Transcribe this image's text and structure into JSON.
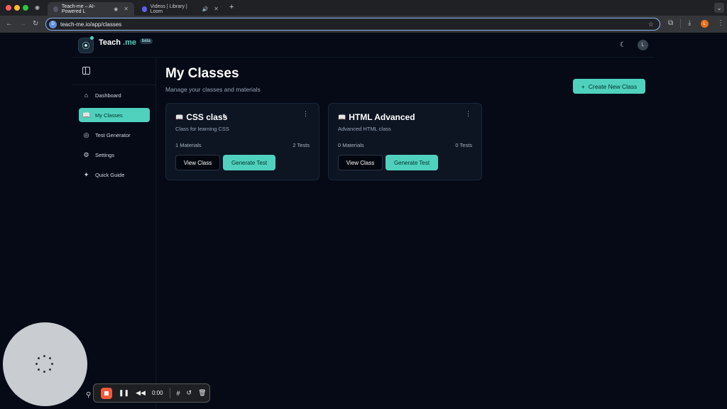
{
  "browser": {
    "tabs": [
      {
        "title": "Teach-me – AI-Powered L"
      },
      {
        "title": "Videos | Library | Loom"
      }
    ],
    "new_tab": "+",
    "url": "teach-me.io/app/classes",
    "profile_initial": "L"
  },
  "app": {
    "brand_main": "Teach",
    "brand_accent": ".me",
    "beta": "beta",
    "user_initial": "L",
    "colors": {
      "accent": "#4fd1bd",
      "background": "#050a16",
      "card": "#0d1523"
    }
  },
  "sidebar": {
    "items": [
      {
        "label": "Dashboard",
        "icon": "home-icon"
      },
      {
        "label": "My Classes",
        "icon": "book-icon",
        "active": true
      },
      {
        "label": "Test Generator",
        "icon": "brain-icon"
      },
      {
        "label": "Settings",
        "icon": "gear-icon"
      },
      {
        "label": "Quick Guide",
        "icon": "sparkle-icon"
      }
    ]
  },
  "main": {
    "title": "My Classes",
    "subtitle": "Manage your classes and materials",
    "create_button": "Create New Class",
    "create_icon": "+"
  },
  "classes": [
    {
      "title": "CSS class",
      "description": "Class for learning CSS",
      "materials": "1 Materials",
      "tests": "2 Tests",
      "view_label": "View Class",
      "generate_label": "Generate Test"
    },
    {
      "title": "HTML Advanced",
      "description": "Advanced HTML class",
      "materials": "0 Materials",
      "tests": "0 Tests",
      "view_label": "View Class",
      "generate_label": "Generate Test"
    }
  ],
  "recorder": {
    "time": "0:00"
  }
}
